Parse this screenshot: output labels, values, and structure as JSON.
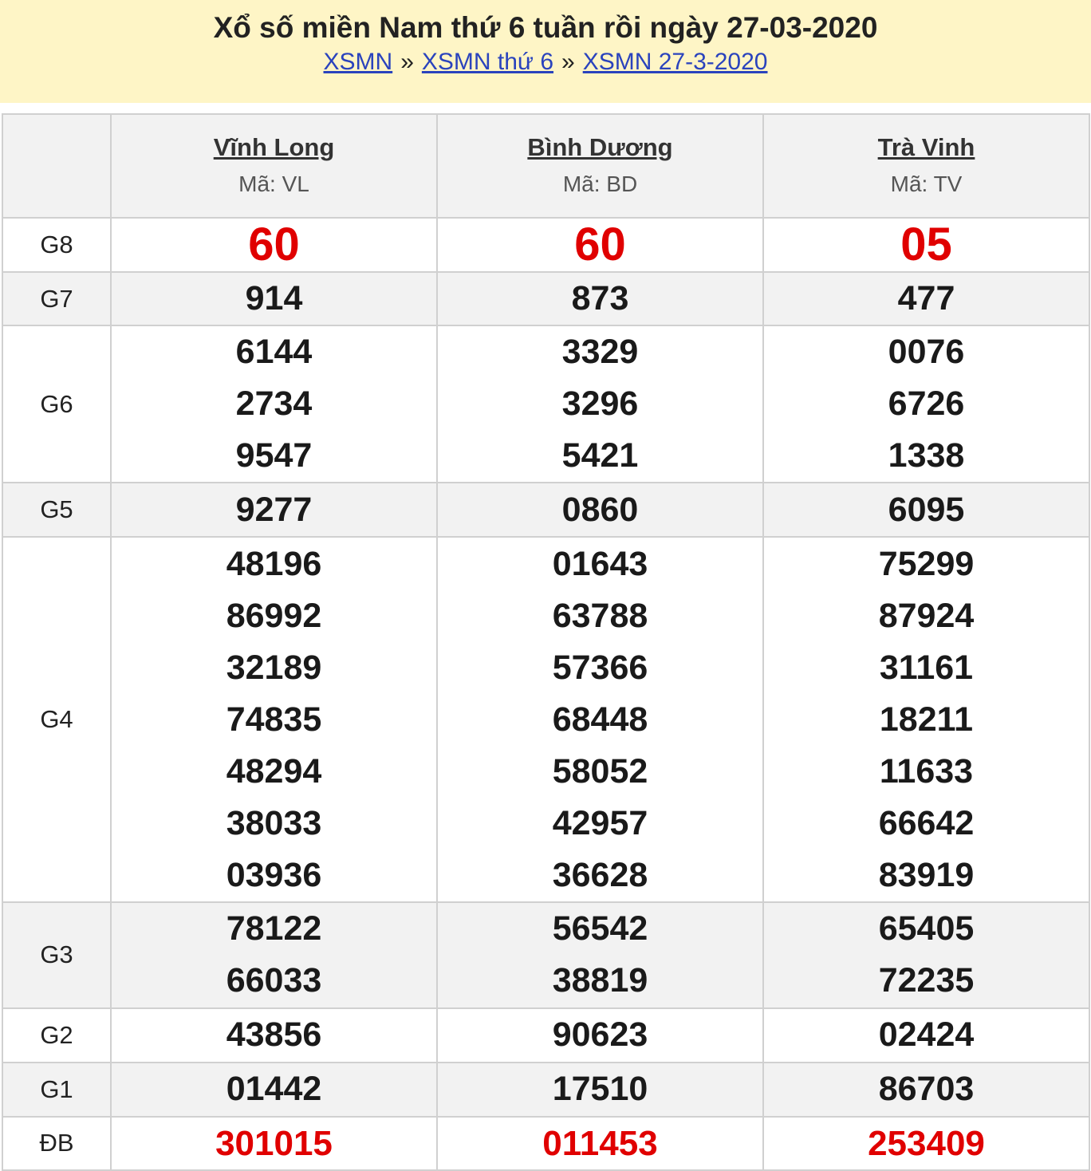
{
  "header": {
    "title": "Xổ số miền Nam thứ 6 tuần rồi ngày 27-03-2020",
    "breadcrumb": [
      {
        "label": "XSMN"
      },
      {
        "label": "XSMN thứ 6"
      },
      {
        "label": "XSMN 27-3-2020"
      }
    ],
    "separator": "»"
  },
  "provinces": [
    {
      "name": "Vĩnh Long",
      "code": "Mã: VL"
    },
    {
      "name": "Bình Dương",
      "code": "Mã: BD"
    },
    {
      "name": "Trà Vinh",
      "code": "Mã: TV"
    }
  ],
  "prizes": [
    {
      "label": "G8",
      "red": true,
      "values": [
        [
          "60"
        ],
        [
          "60"
        ],
        [
          "05"
        ]
      ]
    },
    {
      "label": "G7",
      "values": [
        [
          "914"
        ],
        [
          "873"
        ],
        [
          "477"
        ]
      ]
    },
    {
      "label": "G6",
      "values": [
        [
          "6144",
          "2734",
          "9547"
        ],
        [
          "3329",
          "3296",
          "5421"
        ],
        [
          "0076",
          "6726",
          "1338"
        ]
      ]
    },
    {
      "label": "G5",
      "values": [
        [
          "9277"
        ],
        [
          "0860"
        ],
        [
          "6095"
        ]
      ]
    },
    {
      "label": "G4",
      "values": [
        [
          "48196",
          "86992",
          "32189",
          "74835",
          "48294",
          "38033",
          "03936"
        ],
        [
          "01643",
          "63788",
          "57366",
          "68448",
          "58052",
          "42957",
          "36628"
        ],
        [
          "75299",
          "87924",
          "31161",
          "18211",
          "11633",
          "66642",
          "83919"
        ]
      ]
    },
    {
      "label": "G3",
      "values": [
        [
          "78122",
          "66033"
        ],
        [
          "56542",
          "38819"
        ],
        [
          "65405",
          "72235"
        ]
      ]
    },
    {
      "label": "G2",
      "values": [
        [
          "43856"
        ],
        [
          "90623"
        ],
        [
          "02424"
        ]
      ]
    },
    {
      "label": "G1",
      "values": [
        [
          "01442"
        ],
        [
          "17510"
        ],
        [
          "86703"
        ]
      ]
    },
    {
      "label": "ĐB",
      "red": true,
      "values": [
        [
          "301015"
        ],
        [
          "011453"
        ],
        [
          "253409"
        ]
      ]
    }
  ],
  "colors": {
    "header_bg": "#fef5c6",
    "link": "#2a43bd",
    "highlight": "#e00000",
    "alt_row": "#f2f2f2"
  }
}
